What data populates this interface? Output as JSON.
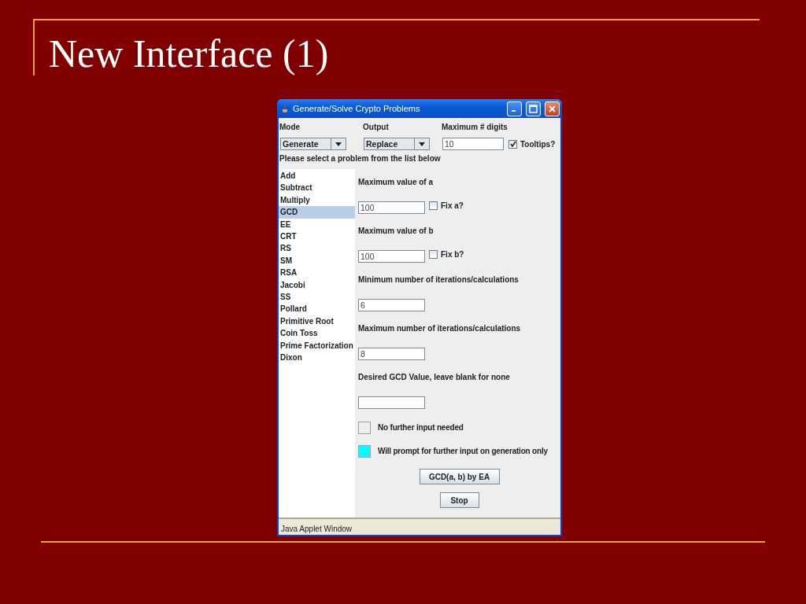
{
  "slide": {
    "title": "New Interface (1)"
  },
  "window": {
    "title": "Generate/Solve Crypto Problems"
  },
  "settings": [
    {
      "label": "Mode",
      "kind": "dropdown",
      "value": "Generate"
    },
    {
      "label": "Output",
      "kind": "dropdown",
      "value": "Replace"
    },
    {
      "label": "Maximum # digits",
      "kind": "field",
      "value": "10"
    }
  ],
  "tooltips": {
    "label": "Tooltips?",
    "checked": true
  },
  "list_prompt": "Please select a problem from the list below",
  "problems": [
    {
      "label": "Add",
      "selected": false
    },
    {
      "label": "Subtract",
      "selected": false
    },
    {
      "label": "Multiply",
      "selected": false
    },
    {
      "label": "GCD",
      "selected": true
    },
    {
      "label": "EE",
      "selected": false
    },
    {
      "label": "CRT",
      "selected": false
    },
    {
      "label": "RS",
      "selected": false
    },
    {
      "label": "SM",
      "selected": false
    },
    {
      "label": "RSA",
      "selected": false
    },
    {
      "label": "Jacobi",
      "selected": false
    },
    {
      "label": "SS",
      "selected": false
    },
    {
      "label": "Pollard",
      "selected": false
    },
    {
      "label": "Primitive Root",
      "selected": false
    },
    {
      "label": "Coin Toss",
      "selected": false
    },
    {
      "label": "Prime Factorization",
      "selected": false
    },
    {
      "label": "Dixon",
      "selected": false
    }
  ],
  "parameters": [
    {
      "label": "Maximum value of a",
      "value": "100",
      "fix": {
        "label": "Fix a?",
        "checked": false
      }
    },
    {
      "label": "Maximum value of b",
      "value": "100",
      "fix": {
        "label": "Fix b?",
        "checked": false
      }
    },
    {
      "label": "Minimum number of iterations/calculations",
      "value": "6"
    },
    {
      "label": "Maximum number of iterations/calculations",
      "value": "8"
    },
    {
      "label": "Desired GCD Value, leave blank for none"
    }
  ],
  "legend": [
    {
      "label": "No further input needed",
      "color": "#eeeeee"
    },
    {
      "label": "Will prompt for further input on generation only",
      "color": "#00ffff"
    }
  ],
  "buttons": [
    "GCD(a, b) by EA",
    "Stop"
  ],
  "status_bar": "Java Applet Window"
}
